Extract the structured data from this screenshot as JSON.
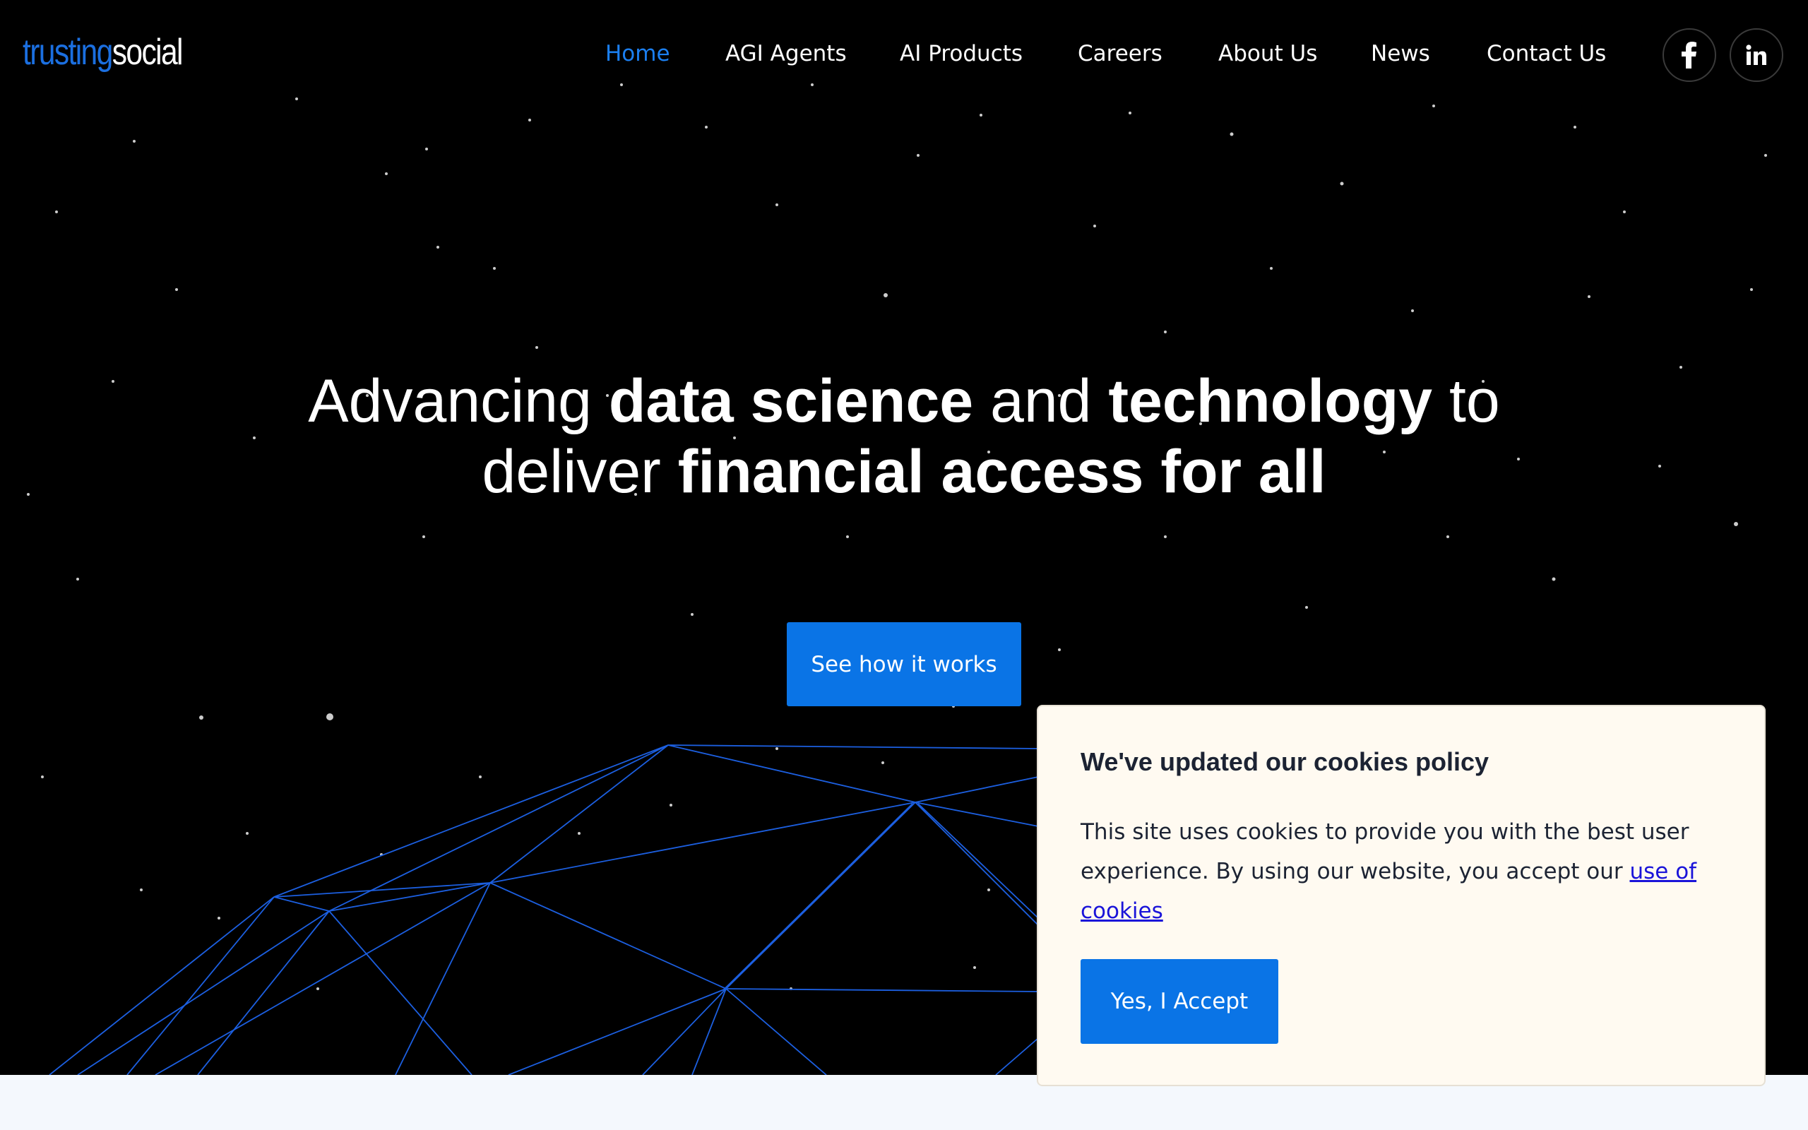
{
  "brand": {
    "logo_part1": "trusting",
    "logo_part2": "social"
  },
  "nav": {
    "items": [
      {
        "label": "Home",
        "active": true
      },
      {
        "label": "AGI Agents",
        "active": false
      },
      {
        "label": "AI Products",
        "active": false
      },
      {
        "label": "Careers",
        "active": false
      },
      {
        "label": "About Us",
        "active": false
      },
      {
        "label": "News",
        "active": false
      },
      {
        "label": "Contact Us",
        "active": false
      }
    ],
    "social": [
      {
        "icon": "facebook-icon"
      },
      {
        "icon": "linkedin-icon"
      }
    ]
  },
  "hero": {
    "line1": {
      "t1": "Advancing ",
      "b1": "data science",
      "t2": " and ",
      "b2": "technology",
      "t3": " to"
    },
    "line2": {
      "t1": "deliver ",
      "b1": "financial access for all"
    },
    "cta_label": "See how it works"
  },
  "cookie": {
    "title": "We've updated our cookies policy",
    "text": "This site uses cookies to provide you with the best user experience. By using our website, you accept our ",
    "link_label": "use of cookies",
    "accept_label": "Yes, I Accept"
  },
  "colors": {
    "accent": "#0a74e6",
    "nav_active": "#1b7ff0",
    "mesh": "#1c5fe0",
    "cookie_bg": "#fffaf1",
    "link": "#1a14d9"
  }
}
